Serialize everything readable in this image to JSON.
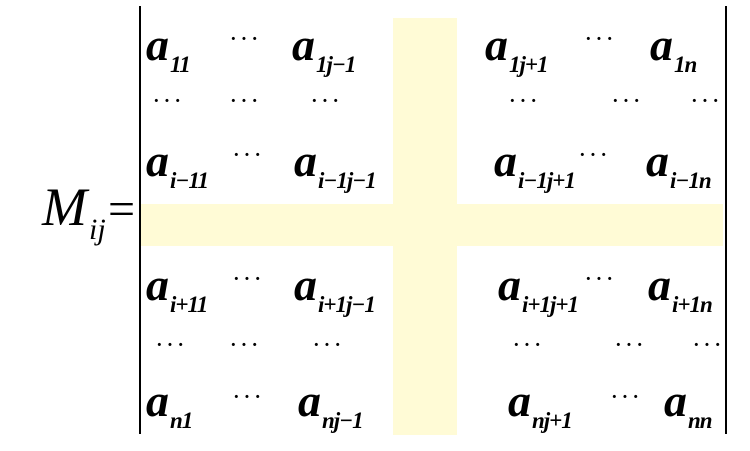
{
  "lhs": {
    "symbol": "M",
    "subscript": "ij"
  },
  "equals": "=",
  "rows": [
    {
      "type": "elements",
      "items": [
        {
          "base": "a",
          "sub": "11"
        },
        {
          "base": "a",
          "sub": "1j−1"
        },
        {
          "base": "a",
          "sub": "1j+1"
        },
        {
          "base": "a",
          "sub": "1n"
        }
      ]
    },
    {
      "type": "elements",
      "items": [
        {
          "base": "a",
          "sub": "i−11"
        },
        {
          "base": "a",
          "sub": "i−1j−1"
        },
        {
          "base": "a",
          "sub": "i−1j+1"
        },
        {
          "base": "a",
          "sub": "i−1n"
        }
      ]
    },
    {
      "type": "elements",
      "items": [
        {
          "base": "a",
          "sub": "i+11"
        },
        {
          "base": "a",
          "sub": "i+1j−1"
        },
        {
          "base": "a",
          "sub": "i+1j+1"
        },
        {
          "base": "a",
          "sub": "i+1n"
        }
      ]
    },
    {
      "type": "elements",
      "items": [
        {
          "base": "a",
          "sub": "n1"
        },
        {
          "base": "a",
          "sub": "nj−1"
        },
        {
          "base": "a",
          "sub": "nj+1"
        },
        {
          "base": "a",
          "sub": "nn"
        }
      ]
    }
  ],
  "hdots": "···",
  "vdots_row": "···"
}
